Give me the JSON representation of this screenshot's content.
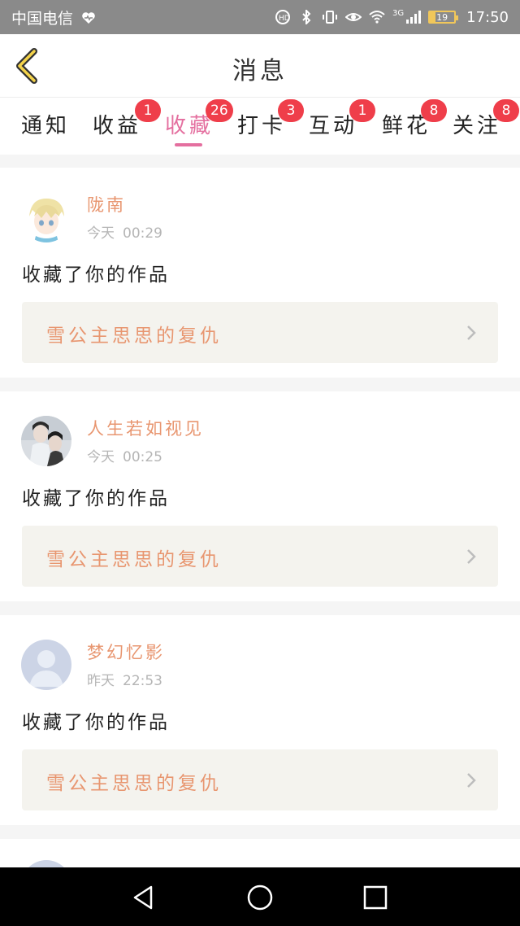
{
  "status_bar": {
    "carrier": "中国电信",
    "network": "3G",
    "battery": "19",
    "time": "17:50"
  },
  "header": {
    "title": "消息"
  },
  "tabs": [
    {
      "label": "通知",
      "badge": ""
    },
    {
      "label": "收益",
      "badge": "1"
    },
    {
      "label": "收藏",
      "badge": "26",
      "active": true
    },
    {
      "label": "打卡",
      "badge": "3"
    },
    {
      "label": "互动",
      "badge": "1"
    },
    {
      "label": "鲜花",
      "badge": "8"
    },
    {
      "label": "关注",
      "badge": "8"
    }
  ],
  "cards": [
    {
      "user": "陇南",
      "day": "今天",
      "time": "00:29",
      "action": "收藏了你的作品",
      "work": "雪公主思思的复仇"
    },
    {
      "user": "人生若如视见",
      "day": "今天",
      "time": "00:25",
      "action": "收藏了你的作品",
      "work": "雪公主思思的复仇"
    },
    {
      "user": "梦幻忆影",
      "day": "昨天",
      "time": "22:53",
      "action": "收藏了你的作品",
      "work": "雪公主思思的复仇"
    }
  ],
  "colors": {
    "accent_pink": "#e46f9f",
    "name_orange": "#e89670",
    "badge_red": "#ef3e4a"
  }
}
